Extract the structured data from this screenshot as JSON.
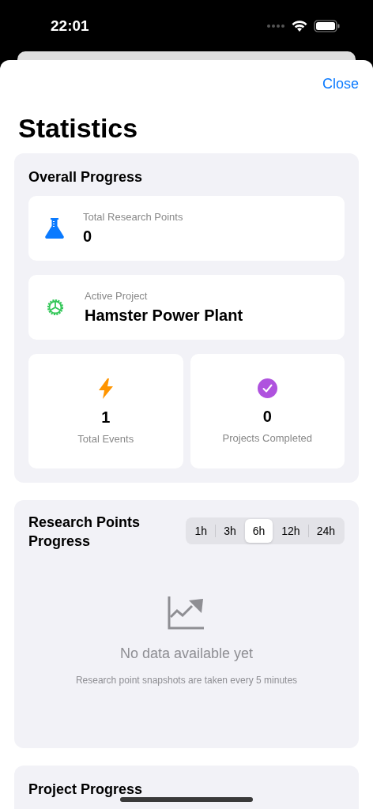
{
  "status_bar": {
    "time": "22:01"
  },
  "header": {
    "close": "Close",
    "title": "Statistics"
  },
  "overall": {
    "title": "Overall Progress",
    "stats": [
      {
        "kind": "row",
        "label": "Total Research Points",
        "value": "0",
        "color": "#0a7aff"
      },
      {
        "kind": "row",
        "label": "Active Project",
        "value": "Hamster Power Plant",
        "color": "#34c759"
      },
      {
        "kind": "tile",
        "label": "Total Events",
        "value": "1",
        "color": "#ff9500"
      },
      {
        "kind": "tile",
        "label": "Projects Completed",
        "value": "0",
        "color": "#af52de"
      }
    ]
  },
  "research": {
    "title": "Research Points Progress",
    "ranges": [
      {
        "label": "1h",
        "selected": false
      },
      {
        "label": "3h",
        "selected": false
      },
      {
        "label": "6h",
        "selected": true
      },
      {
        "label": "12h",
        "selected": false
      },
      {
        "label": "24h",
        "selected": false
      }
    ],
    "empty_title": "No data available yet",
    "empty_note": "Research point snapshots are taken every 5 minutes"
  },
  "project": {
    "title": "Project Progress"
  }
}
